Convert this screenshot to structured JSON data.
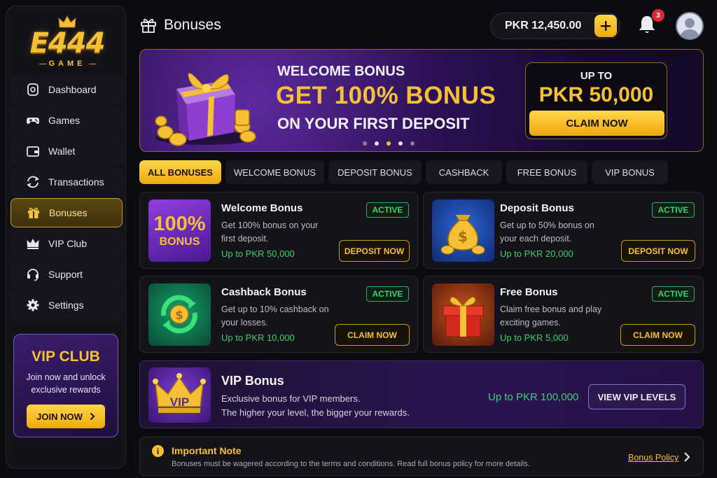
{
  "brand": {
    "logo_text": "E444",
    "logo_sub": "GAME"
  },
  "sidebar": {
    "items": [
      {
        "label": "Dashboard",
        "icon": "dashboard-icon"
      },
      {
        "label": "Games",
        "icon": "gamepad-icon"
      },
      {
        "label": "Wallet",
        "icon": "wallet-icon"
      },
      {
        "label": "Transactions",
        "icon": "transactions-icon"
      },
      {
        "label": "Bonuses",
        "icon": "gift-icon",
        "active": true
      },
      {
        "label": "VIP Club",
        "icon": "crown-icon"
      },
      {
        "label": "Support",
        "icon": "headset-icon"
      },
      {
        "label": "Settings",
        "icon": "gear-icon"
      }
    ],
    "vip_card": {
      "title": "VIP CLUB",
      "description": "Join now and unlock exclusive rewards",
      "button": "JOIN NOW"
    }
  },
  "header": {
    "title": "Bonuses",
    "balance": "PKR 12,450.00",
    "notification_count": "3"
  },
  "hero": {
    "line1": "WELCOME BONUS",
    "line2": "GET 100% BONUS",
    "line3": "ON YOUR FIRST DEPOSIT",
    "promo_top": "UP TO",
    "promo_amount": "PKR 50,000",
    "promo_button": "CLAIM NOW",
    "slide_count": 5,
    "active_slide": 3
  },
  "tabs": [
    "ALL BONUSES",
    "WELCOME BONUS",
    "DEPOSIT BONUS",
    "CASHBACK",
    "FREE BONUS",
    "VIP BONUS"
  ],
  "cards": [
    {
      "title": "Welcome Bonus",
      "description": "Get 100% bonus on your first deposit.",
      "amount": "Up to PKR 50,000",
      "status": "ACTIVE",
      "action": "DEPOSIT NOW",
      "thumb_line1": "100%",
      "thumb_line2": "BONUS"
    },
    {
      "title": "Deposit Bonus",
      "description": "Get up to 50% bonus on your each deposit.",
      "amount": "Up to PKR 20,000",
      "status": "ACTIVE",
      "action": "DEPOSIT NOW"
    },
    {
      "title": "Cashback Bonus",
      "description": "Get up to 10% cashback on your losses.",
      "amount": "Up to PKR 10,000",
      "status": "ACTIVE",
      "action": "CLAIM NOW"
    },
    {
      "title": "Free Bonus",
      "description": "Claim free bonus and play exciting games.",
      "amount": "Up to PKR 5,000",
      "status": "ACTIVE",
      "action": "CLAIM NOW"
    }
  ],
  "vip_bonus": {
    "title": "VIP Bonus",
    "line1": "Exclusive bonus for VIP members.",
    "line2": "The higher your level, the bigger your rewards.",
    "amount": "Up to PKR 100,000",
    "action": "VIEW VIP LEVELS",
    "thumb_text": "VIP"
  },
  "note": {
    "icon_text": "i",
    "title": "Important Note",
    "description": "Bonuses must be wagered according to the terms and conditions. Read full bonus policy for more details.",
    "link": "Bonus Policy"
  },
  "colors": {
    "accent": "#f5c036",
    "success": "#3bd16b",
    "background": "#0b0b12",
    "purple": "#3a1d6b"
  }
}
